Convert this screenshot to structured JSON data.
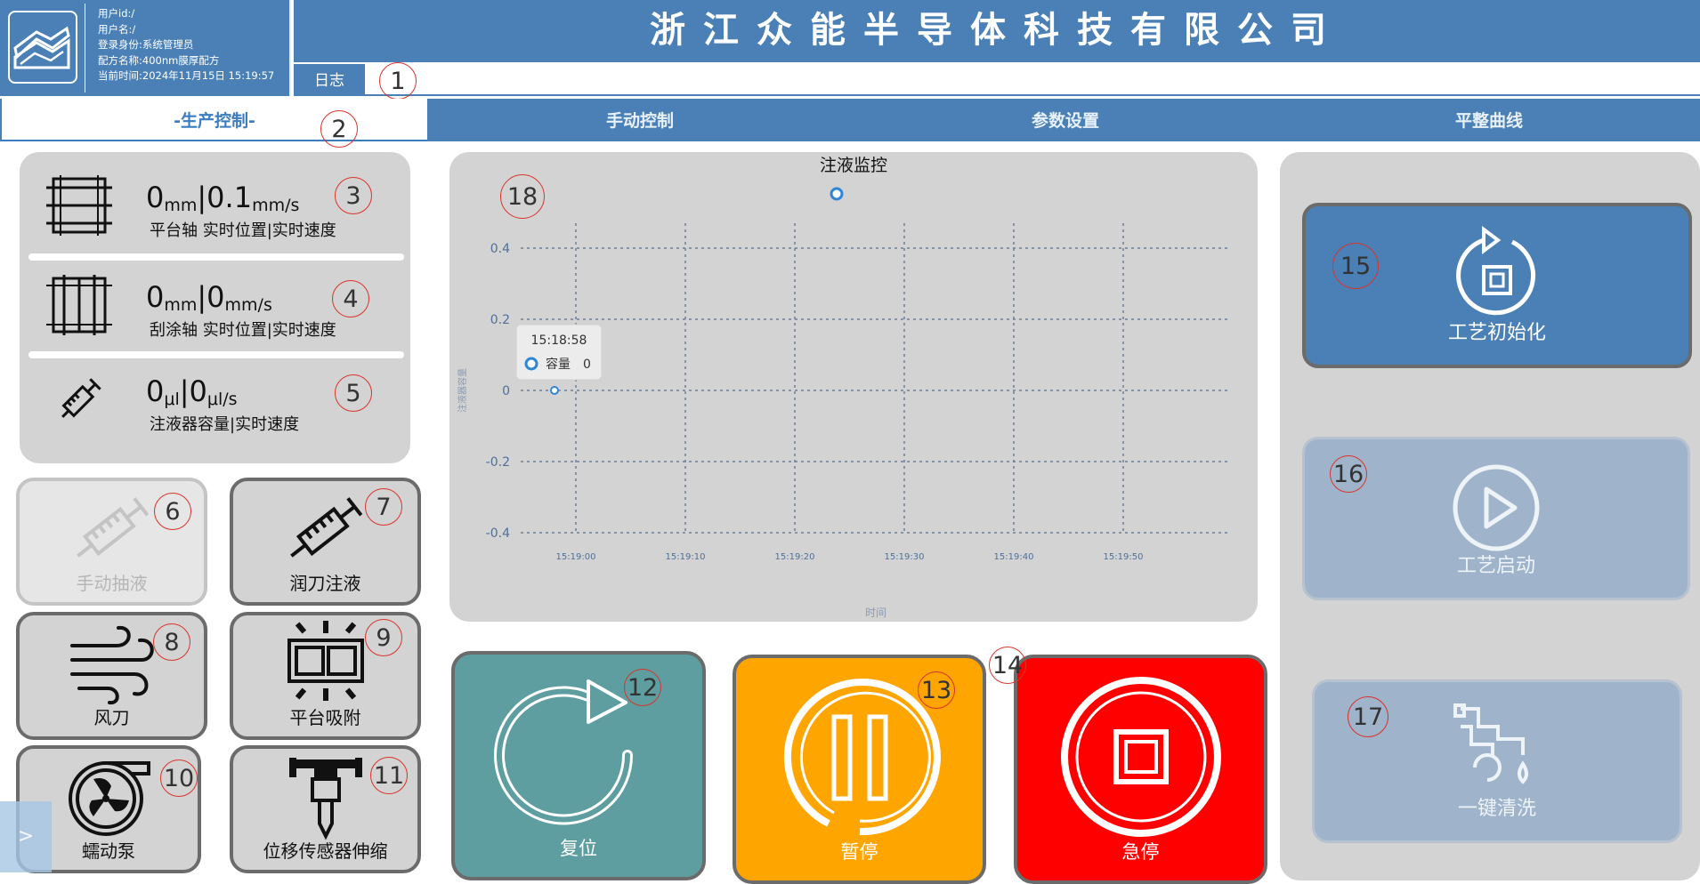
{
  "header": {
    "user_id": "用户id:/",
    "user_name": "用户名:/",
    "login_role": "登录身份:系统管理员",
    "recipe": "配方名称:400nm膜厚配方",
    "current_time": "当前时间:2024年11月15日 15:19:57",
    "company_title": "浙江众能半导体科技有限公司",
    "log_tab": "日志"
  },
  "tabs": [
    {
      "label": "-生产控制-",
      "active": true
    },
    {
      "label": "手动控制",
      "active": false
    },
    {
      "label": "参数设置",
      "active": false
    },
    {
      "label": "平整曲线",
      "active": false
    }
  ],
  "status": {
    "platform": {
      "pos": "0",
      "pos_unit": "mm",
      "speed": "0.1",
      "speed_unit": "mm/s",
      "label": "平台轴 实时位置|实时速度"
    },
    "scraper": {
      "pos": "0",
      "pos_unit": "mm",
      "speed": "0",
      "speed_unit": "mm/s",
      "label": "刮涂轴 实时位置|实时速度"
    },
    "syringe": {
      "pos": "0",
      "pos_unit": "μl",
      "speed": "0",
      "speed_unit": "μl/s",
      "label": "注液器容量|实时速度"
    }
  },
  "tools": {
    "manual_draw": "手动抽液",
    "knife_inject": "润刀注液",
    "air_knife": "风刀",
    "platform_suction": "平台吸附",
    "peristaltic_pump": "蠕动泵",
    "sensor_extend": "位移传感器伸缩"
  },
  "actions": {
    "reset": "复位",
    "pause": "暂停",
    "estop": "急停"
  },
  "process": {
    "init": "工艺初始化",
    "start": "工艺启动",
    "clean": "一键清洗"
  },
  "callouts": [
    "1",
    "2",
    "3",
    "4",
    "5",
    "6",
    "7",
    "8",
    "9",
    "10",
    "11",
    "12",
    "13",
    "14",
    "15",
    "16",
    "17",
    "18"
  ],
  "colors": {
    "brand_blue": "#4a80b6",
    "panel_gray": "#d3d3d3",
    "reset_teal": "#5e9ea0",
    "pause_orange": "#ffa500",
    "estop_red": "#ff0000",
    "disabled_blue": "#9fb4cb"
  },
  "chart_data": {
    "type": "line",
    "title": "注液监控",
    "xlabel": "时间",
    "ylabel": "注液器容量",
    "series": [
      {
        "name": "容量",
        "values": [
          0
        ]
      }
    ],
    "x": [
      "15:18:58"
    ],
    "xticks": [
      "15:19:00",
      "15:19:10",
      "15:19:20",
      "15:19:30",
      "15:19:40",
      "15:19:50"
    ],
    "yticks": [
      "0.4",
      "0.2",
      "0",
      "-0.2",
      "-0.4"
    ],
    "ylim": [
      -0.4,
      0.4
    ],
    "grid": true,
    "legend": "top",
    "tooltip": {
      "time": "15:18:58",
      "series": "容量",
      "value": "0"
    }
  }
}
